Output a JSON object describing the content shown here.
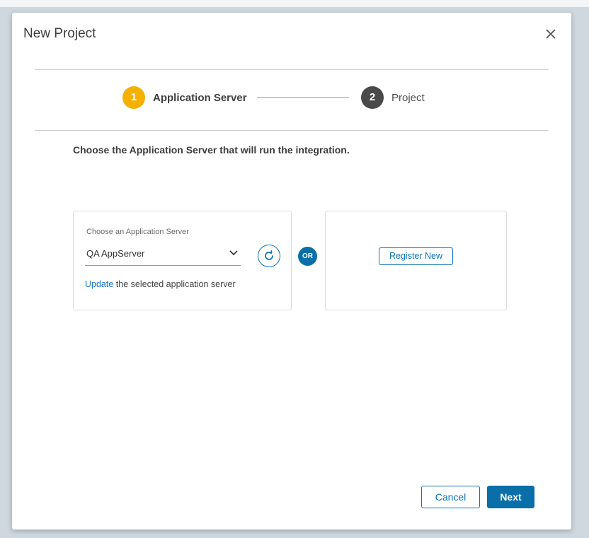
{
  "dialog": {
    "title": "New Project"
  },
  "stepper": {
    "steps": [
      {
        "number": "1",
        "label": "Application Server",
        "state": "active",
        "color": "#f6b000"
      },
      {
        "number": "2",
        "label": "Project",
        "state": "upcoming",
        "color": "#4a4a4a"
      }
    ]
  },
  "instruction": "Choose the Application Server that will run the integration.",
  "server_card": {
    "field_label": "Choose an Application Server",
    "selected_value": "QA AppServer",
    "update_link": "Update",
    "update_text": " the selected application server"
  },
  "or_label": "OR",
  "register_card": {
    "button_label": "Register New"
  },
  "footer": {
    "cancel_label": "Cancel",
    "next_label": "Next"
  },
  "colors": {
    "accent": "#0a6fa8",
    "active_step": "#f6b000",
    "link": "#1a72c0"
  }
}
